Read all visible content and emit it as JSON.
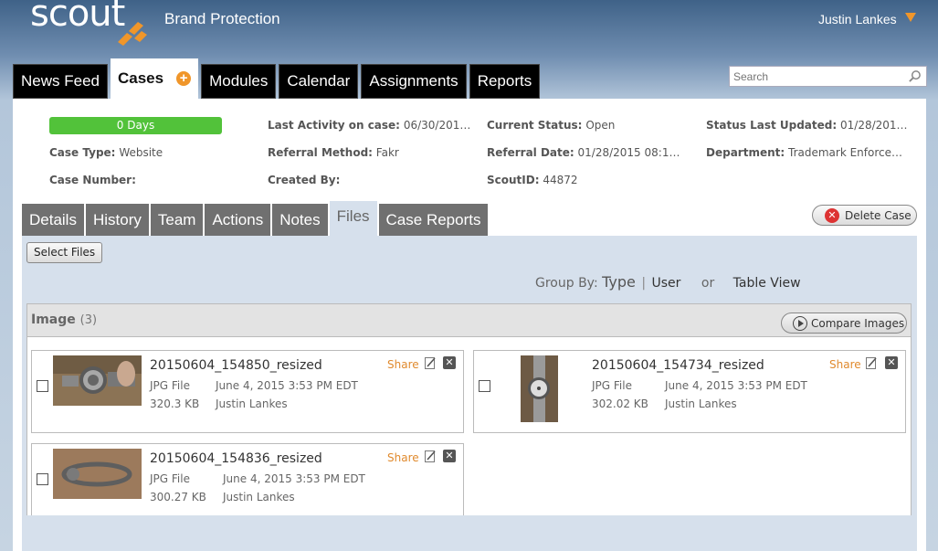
{
  "header": {
    "logo_text": "scout",
    "app_title": "Brand Protection",
    "user_name": "Justin Lankes"
  },
  "main_tabs": [
    {
      "label": "News Feed"
    },
    {
      "label": "Cases"
    },
    {
      "label": "Modules"
    },
    {
      "label": "Calendar"
    },
    {
      "label": "Assignments"
    },
    {
      "label": "Reports"
    }
  ],
  "search": {
    "placeholder": "Search"
  },
  "case": {
    "days": "0 Days",
    "last_activity_label": "Last Activity on case:",
    "last_activity_value": "06/30/201…",
    "current_status_label": "Current Status:",
    "current_status_value": "Open",
    "status_updated_label": "Status Last Updated:",
    "status_updated_value": "01/28/201…",
    "case_type_label": "Case Type:",
    "case_type_value": "Website",
    "referral_method_label": "Referral Method:",
    "referral_method_value": "Fakr",
    "referral_date_label": "Referral Date:",
    "referral_date_value": "01/28/2015 08:1…",
    "department_label": "Department:",
    "department_value": "Trademark Enforce…",
    "case_number_label": "Case Number:",
    "created_by_label": "Created By:",
    "scoutid_label": "ScoutID:",
    "scoutid_value": "44872"
  },
  "sub_tabs": [
    {
      "label": "Details"
    },
    {
      "label": "History"
    },
    {
      "label": "Team"
    },
    {
      "label": "Actions"
    },
    {
      "label": "Notes"
    },
    {
      "label": "Files"
    },
    {
      "label": "Case Reports"
    }
  ],
  "delete_case_label": "Delete Case",
  "select_files_label": "Select Files",
  "group_by": {
    "label": "Group By:",
    "type": "Type",
    "separator": "|",
    "user": "User",
    "or": "or",
    "table_view": "Table View"
  },
  "image_section": {
    "title": "Image",
    "count": "(3)",
    "compare_label": "Compare Images"
  },
  "files": [
    {
      "name": "20150604_154850_resized",
      "type": "JPG File",
      "date": "June 4, 2015 3:53 PM EDT",
      "size": "320.3 KB",
      "user": "Justin Lankes",
      "share": "Share"
    },
    {
      "name": "20150604_154734_resized",
      "type": "JPG File",
      "date": "June 4, 2015 3:53 PM EDT",
      "size": "302.02 KB",
      "user": "Justin Lankes",
      "share": "Share"
    },
    {
      "name": "20150604_154836_resized",
      "type": "JPG File",
      "date": "June 4, 2015 3:53 PM EDT",
      "size": "300.27 KB",
      "user": "Justin Lankes",
      "share": "Share"
    }
  ],
  "colors": {
    "accent_orange": "#f0962a",
    "status_green": "#52c23a",
    "delete_red": "#d33333"
  }
}
